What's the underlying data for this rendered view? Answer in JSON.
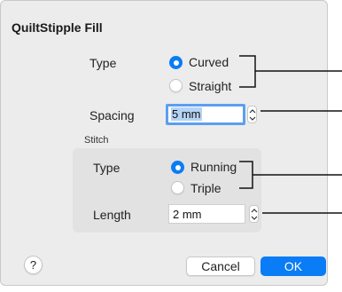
{
  "dialog": {
    "title": "QuiltStipple Fill",
    "type_label": "Type",
    "type_options": [
      "Curved",
      "Straight"
    ],
    "type_selected": "Curved",
    "spacing_label": "Spacing",
    "spacing_value": "5 mm",
    "stitch_group_label": "Stitch",
    "stitch_type_label": "Type",
    "stitch_type_options": [
      "Running",
      "Triple"
    ],
    "stitch_type_selected": "Running",
    "length_label": "Length",
    "length_value": "2 mm",
    "help_label": "?",
    "cancel_label": "Cancel",
    "ok_label": "OK"
  },
  "colors": {
    "accent": "#0a7cf5",
    "dialog_bg": "#ececec",
    "group_bg": "#e2e2e2"
  }
}
